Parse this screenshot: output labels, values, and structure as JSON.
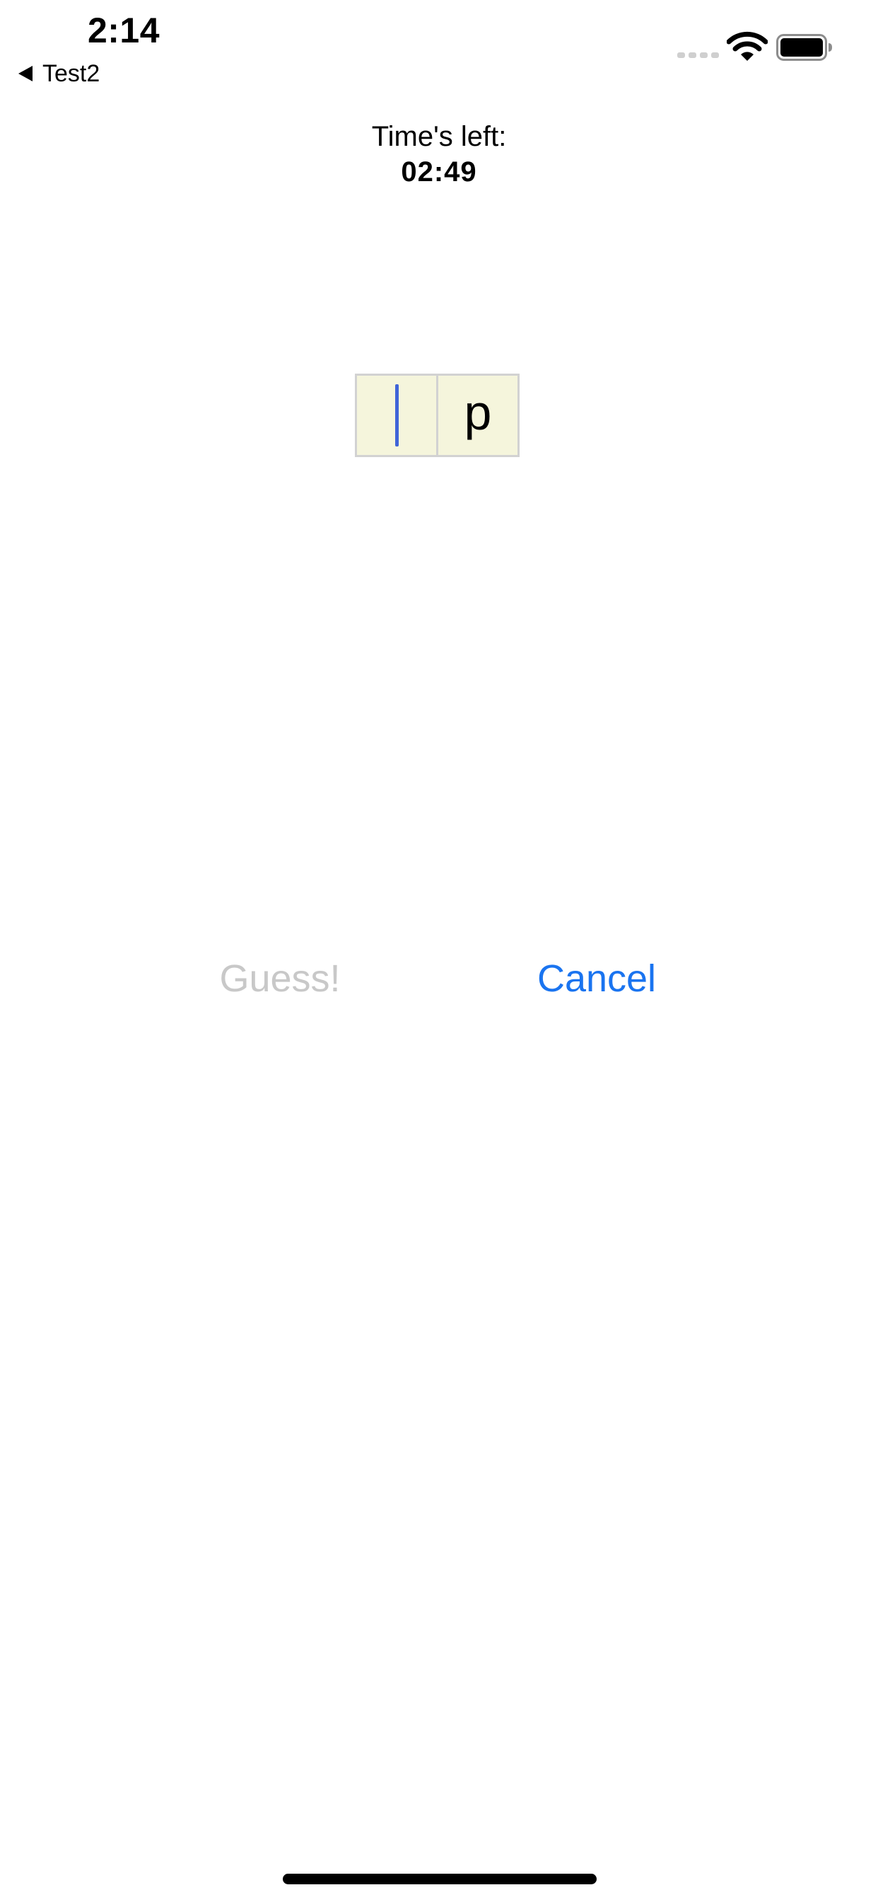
{
  "status_bar": {
    "time": "2:14",
    "signal_icon": "signal-dots-icon",
    "wifi_icon": "wifi-icon",
    "battery_icon": "battery-full-icon"
  },
  "nav": {
    "back_label": "Test2",
    "back_icon": "back-triangle-icon"
  },
  "timer": {
    "label": "Time's left:",
    "value": "02:49"
  },
  "word": {
    "cells": [
      "",
      "p"
    ],
    "active_cell": 0,
    "cell_background": "#f5f5dc",
    "cursor_color": "#3f64d8"
  },
  "actions": {
    "guess_label": "Guess!",
    "guess_enabled": false,
    "cancel_label": "Cancel",
    "tint_color": "#1a74f0",
    "disabled_color": "#c8c8c8"
  }
}
